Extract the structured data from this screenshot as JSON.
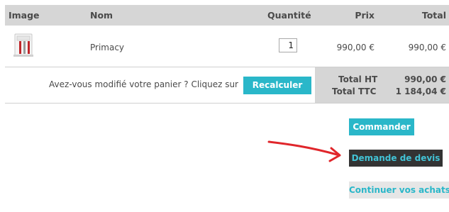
{
  "table": {
    "headers": {
      "image": "Image",
      "name": "Nom",
      "quantity": "Quantité",
      "price": "Prix",
      "total": "Total"
    },
    "rows": [
      {
        "name": "Primacy",
        "quantity": "1",
        "price": "990,00 €",
        "total": "990,00 €",
        "image_icon": "card-printer-icon"
      }
    ]
  },
  "summary": {
    "prompt": "Avez-vous modifié votre panier ? Cliquez sur",
    "recalc_label": "Recalculer",
    "total_ht_label": "Total HT",
    "total_ht_value": "990,00 €",
    "total_ttc_label": "Total TTC",
    "total_ttc_value": "1 184,04 €"
  },
  "actions": {
    "order_label": "Commander",
    "quote_label": "Demande de devis",
    "continue_label": "Continuer vos achats"
  },
  "colors": {
    "accent": "#2ab7c9",
    "header_bg": "#d6d6d6",
    "dark_button": "#333333",
    "annotation_arrow": "#e0262b"
  }
}
